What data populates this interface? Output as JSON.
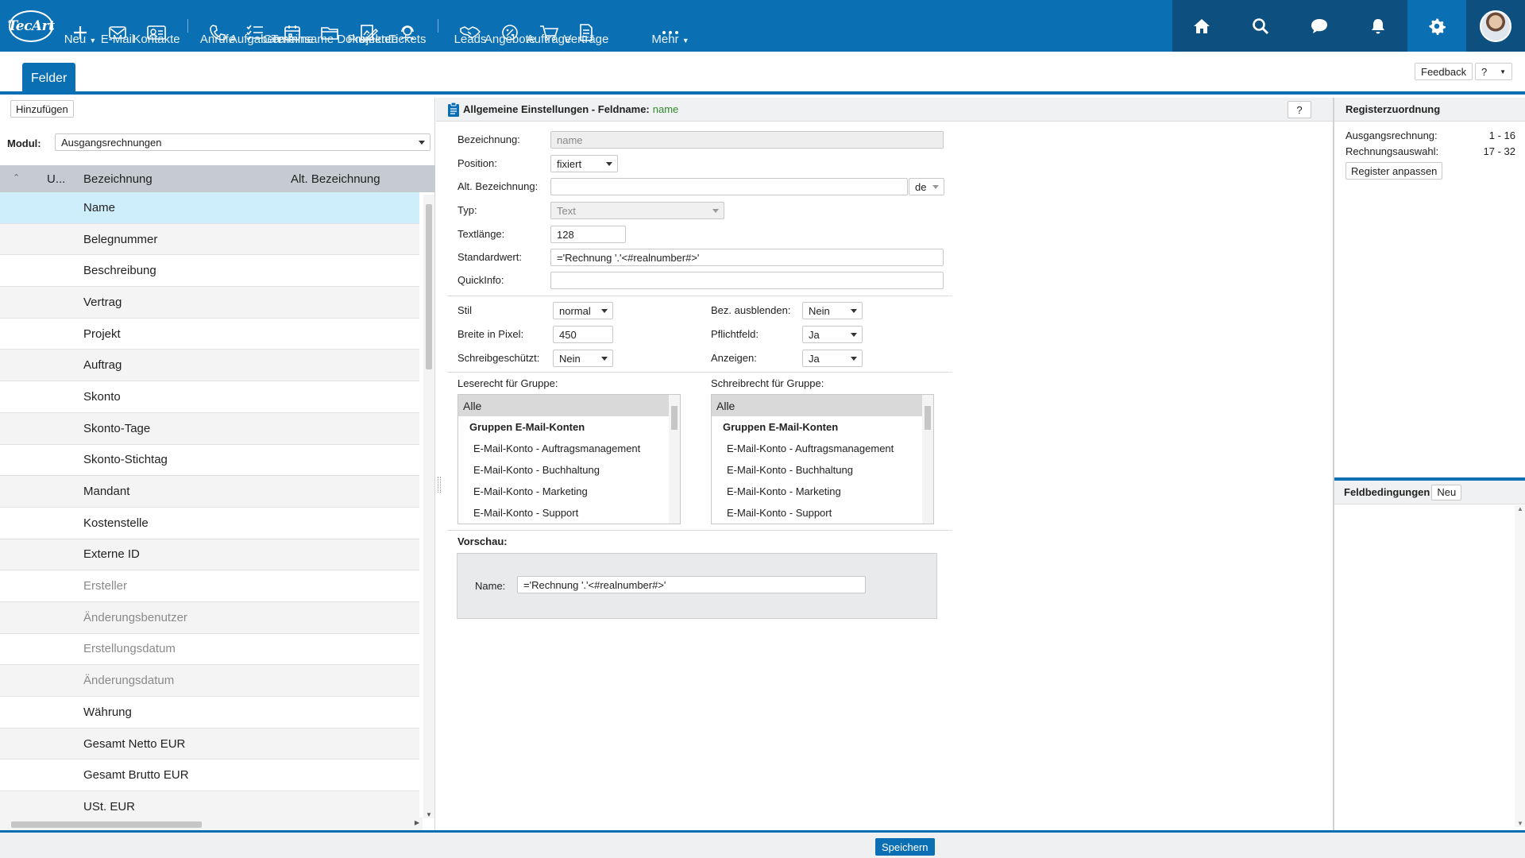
{
  "nav": {
    "logo_text": "TecArt",
    "items": [
      {
        "label": "Neu",
        "icon": "plus-icon"
      },
      {
        "label": "E-Mail",
        "icon": "mail-icon"
      },
      {
        "label": "Kontakte",
        "icon": "contact-card-icon"
      },
      {
        "label": "Anrufe",
        "icon": "phone-icon"
      },
      {
        "label": "Aufgaben",
        "icon": "checklist-icon"
      },
      {
        "label": "Termine",
        "icon": "calendar-icon"
      },
      {
        "label": "Gemeinsame Dokumente",
        "icon": "folder-icon"
      },
      {
        "label": "Projekte",
        "icon": "projects-icon"
      },
      {
        "label": "Tickets",
        "icon": "headset-icon"
      },
      {
        "label": "Leads",
        "icon": "handshake-icon"
      },
      {
        "label": "Angebote",
        "icon": "percent-badge-icon"
      },
      {
        "label": "Aufträge",
        "icon": "cart-icon"
      },
      {
        "label": "Verträge",
        "icon": "contract-icon"
      },
      {
        "label": "Mehr",
        "icon": "more-dots-icon"
      }
    ]
  },
  "tabs": {
    "felder": "Felder",
    "feedback": "Feedback",
    "help": "?"
  },
  "left": {
    "add_button": "Hinzufügen",
    "modul_label": "Modul:",
    "modul_value": "Ausgangsrechnungen",
    "columns": [
      "U...",
      "Bezeichnung",
      "Alt. Bezeichnung"
    ],
    "rows": [
      {
        "name": "Name",
        "state": "selected"
      },
      {
        "name": "Belegnummer",
        "state": "normal"
      },
      {
        "name": "Beschreibung",
        "state": "normal"
      },
      {
        "name": "Vertrag",
        "state": "normal"
      },
      {
        "name": "Projekt",
        "state": "normal"
      },
      {
        "name": "Auftrag",
        "state": "normal"
      },
      {
        "name": "Skonto",
        "state": "normal"
      },
      {
        "name": "Skonto-Tage",
        "state": "normal"
      },
      {
        "name": "Skonto-Stichtag",
        "state": "normal"
      },
      {
        "name": "Mandant",
        "state": "normal"
      },
      {
        "name": "Kostenstelle",
        "state": "normal"
      },
      {
        "name": "Externe ID",
        "state": "normal"
      },
      {
        "name": "Ersteller",
        "state": "muted"
      },
      {
        "name": "Änderungsbenutzer",
        "state": "muted"
      },
      {
        "name": "Erstellungsdatum",
        "state": "muted"
      },
      {
        "name": "Änderungsdatum",
        "state": "muted"
      },
      {
        "name": "Währung",
        "state": "normal"
      },
      {
        "name": "Gesamt Netto EUR",
        "state": "normal"
      },
      {
        "name": "Gesamt Brutto EUR",
        "state": "normal"
      },
      {
        "name": "USt. EUR",
        "state": "normal"
      }
    ]
  },
  "main": {
    "title": "Allgemeine Einstellungen - Feldname:",
    "fieldname": "name",
    "help": "?",
    "fields": {
      "bezeichnung_label": "Bezeichnung:",
      "bezeichnung_value": "name",
      "position_label": "Position:",
      "position_value": "fixiert",
      "altbez_label": "Alt. Bezeichnung:",
      "altbez_value": "",
      "lang_value": "de",
      "typ_label": "Typ:",
      "typ_value": "Text",
      "textlaenge_label": "Textlänge:",
      "textlaenge_value": "128",
      "standardwert_label": "Standardwert:",
      "standardwert_value": "='Rechnung '.'<#realnumber#>'",
      "quickinfo_label": "QuickInfo:",
      "quickinfo_value": "",
      "stil_label": "Stil",
      "stil_value": "normal",
      "breite_label": "Breite in Pixel:",
      "breite_value": "450",
      "schreibgeschuetzt_label": "Schreibgeschützt:",
      "schreibgeschuetzt_value": "Nein",
      "bezausblenden_label": "Bez. ausblenden:",
      "bezausblenden_value": "Nein",
      "pflichtfeld_label": "Pflichtfeld:",
      "pflichtfeld_value": "Ja",
      "anzeigen_label": "Anzeigen:",
      "anzeigen_value": "Ja"
    },
    "leserecht_label": "Leserecht für Gruppe:",
    "schreibrecht_label": "Schreibrecht für Gruppe:",
    "group_items": [
      "Alle",
      "Gruppen E-Mail-Konten",
      "E-Mail-Konto - Auftragsmanagement",
      "E-Mail-Konto - Buchhaltung",
      "E-Mail-Konto - Marketing",
      "E-Mail-Konto - Support"
    ],
    "vorschau_label": "Vorschau:",
    "preview_label": "Name:",
    "preview_value": "='Rechnung '.'<#realnumber#>'"
  },
  "right": {
    "register_title": "Registerzuordnung",
    "registers": [
      {
        "name": "Ausgangsrechnung:",
        "range": "1 - 16"
      },
      {
        "name": "Rechnungsauswahl:",
        "range": "17 - 32"
      }
    ],
    "register_button": "Register anpassen",
    "conditions_title": "Feldbedingungen",
    "conditions_new": "Neu"
  },
  "bottom": {
    "save": "Speichern"
  },
  "colors": {
    "primary": "#0b6fb3",
    "dark_nav": "#0d4f7e",
    "selected_row": "#cfeefc",
    "fieldname_green": "#2e8b2e"
  }
}
